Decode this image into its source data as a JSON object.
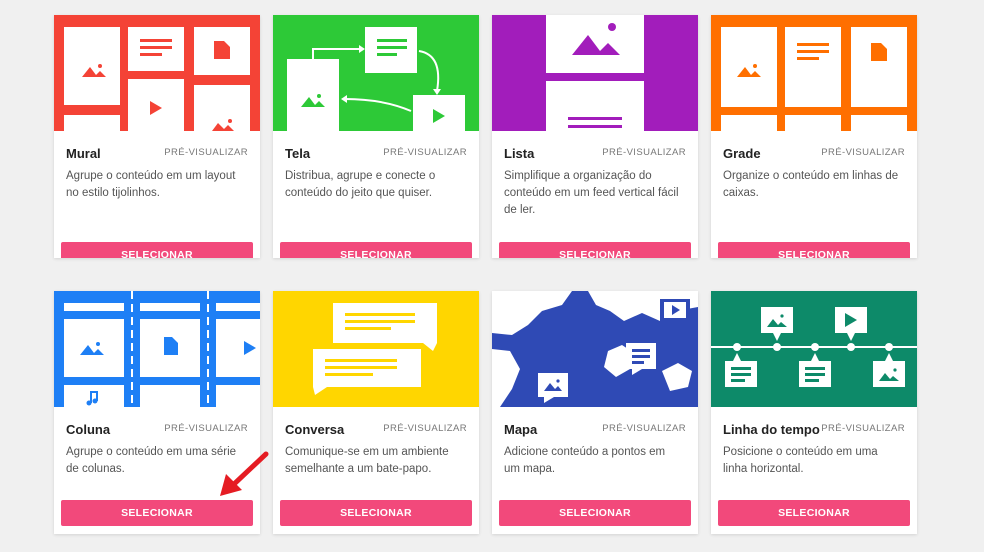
{
  "preview_label": "PRÉ-VISUALIZAR",
  "select_label": "SELECIONAR",
  "colors": {
    "mural": "#f44336",
    "tela": "#2dc937",
    "lista": "#a21dbb",
    "grade": "#ff6f00",
    "coluna": "#1e7ff5",
    "conversa": "#ffd600",
    "mapa": "#2f4ab5",
    "linha": "#0d8a69",
    "button": "#f2497b",
    "arrow": "#e51c23"
  },
  "cards": [
    {
      "title": "Mural",
      "desc": "Agrupe o conteúdo em um layout no estilo tijolinhos."
    },
    {
      "title": "Tela",
      "desc": "Distribua, agrupe e conecte o conteúdo do jeito que quiser."
    },
    {
      "title": "Lista",
      "desc": "Simplifique a organização do conteúdo em um feed vertical fácil de ler."
    },
    {
      "title": "Grade",
      "desc": "Organize o conteúdo em linhas de caixas."
    },
    {
      "title": "Coluna",
      "desc": "Agrupe o conteúdo em uma série de colunas."
    },
    {
      "title": "Conversa",
      "desc": "Comunique-se em um ambiente semelhante a um bate-papo."
    },
    {
      "title": "Mapa",
      "desc": "Adicione conteúdo a pontos em um mapa."
    },
    {
      "title": "Linha do tempo",
      "desc": "Posicione o conteúdo em uma linha horizontal."
    }
  ],
  "icons": {
    "image": "image-icon",
    "document": "document-icon",
    "play": "play-icon",
    "text": "text-icon",
    "music": "music-icon",
    "pointer": "red-arrow-pointer"
  }
}
